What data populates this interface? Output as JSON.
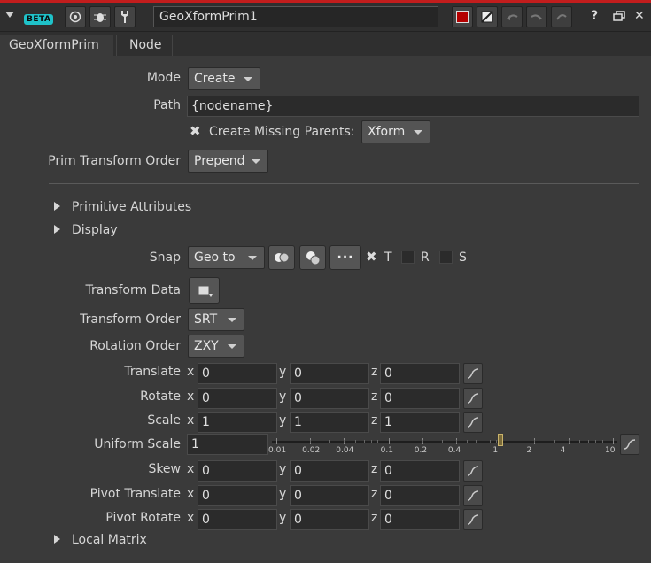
{
  "header": {
    "beta_badge": "BETA",
    "node_name": "GeoXformPrim1",
    "icons": [
      "collapse-triangle-icon",
      "target-icon",
      "bug-icon",
      "wrench-icon",
      "red-display-icon",
      "bypass-icon",
      "undo-icon",
      "redo-icon",
      "reload-icon",
      "help-icon",
      "float-icon",
      "close-icon"
    ],
    "help": "?",
    "close": "✕"
  },
  "tabs": [
    {
      "label": "GeoXformPrim",
      "active": true
    },
    {
      "label": "Node",
      "active": false
    }
  ],
  "params": {
    "mode": {
      "label": "Mode",
      "value": "Create"
    },
    "path": {
      "label": "Path",
      "value": "{nodename}"
    },
    "create_missing": {
      "label": "Create Missing Parents:",
      "checked": true,
      "value": "Xform"
    },
    "prim_transform_order": {
      "label": "Prim Transform Order",
      "value": "Prepend"
    },
    "folders": {
      "primitive_attributes": "Primitive Attributes",
      "display": "Display",
      "local_matrix": "Local Matrix"
    },
    "snap": {
      "label": "Snap",
      "value": "Geo to",
      "t": "T",
      "r": "R",
      "s": "S",
      "t_checked": true,
      "r_checked": false,
      "s_checked": false
    },
    "transform_data": {
      "label": "Transform Data"
    },
    "transform_order": {
      "label": "Transform Order",
      "value": "SRT"
    },
    "rotation_order": {
      "label": "Rotation Order",
      "value": "ZXY"
    },
    "axis": {
      "x": "x",
      "y": "y",
      "z": "z"
    },
    "translate": {
      "label": "Translate",
      "x": "0",
      "y": "0",
      "z": "0"
    },
    "rotate": {
      "label": "Rotate",
      "x": "0",
      "y": "0",
      "z": "0"
    },
    "scale": {
      "label": "Scale",
      "x": "1",
      "y": "1",
      "z": "1"
    },
    "uniform_scale": {
      "label": "Uniform Scale",
      "value": "1",
      "ticks": [
        "0.01",
        "0.02",
        "0.04",
        "0.1",
        "0.2",
        "0.4",
        "1",
        "2",
        "4",
        "10"
      ],
      "slider_value": 1
    },
    "skew": {
      "label": "Skew",
      "x": "0",
      "y": "0",
      "z": "0"
    },
    "pivot_translate": {
      "label": "Pivot Translate",
      "x": "0",
      "y": "0",
      "z": "0"
    },
    "pivot_rotate": {
      "label": "Pivot Rotate",
      "x": "0",
      "y": "0",
      "z": "0"
    }
  }
}
